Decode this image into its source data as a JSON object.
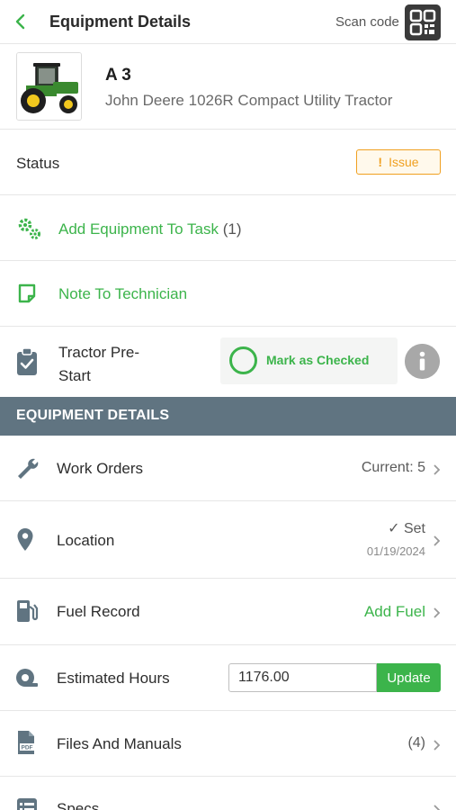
{
  "header": {
    "title": "Equipment Details",
    "scan_label": "Scan code"
  },
  "equipment": {
    "name": "A 3",
    "model": "John Deere 1026R Compact Utility Tractor"
  },
  "status": {
    "label": "Status",
    "badge": "Issue",
    "badge_mark": "!"
  },
  "add_to_task": {
    "label": "Add Equipment To Task",
    "count": "(1)"
  },
  "note": {
    "label": "Note To Technician"
  },
  "prestart": {
    "label_line1": "Tractor Pre-",
    "label_line2": "Start",
    "button": "Mark as Checked"
  },
  "section": {
    "title": "EQUIPMENT DETAILS"
  },
  "rows": {
    "work_orders": {
      "label": "Work Orders",
      "value": "Current: 5"
    },
    "location": {
      "label": "Location",
      "value": "Set",
      "date": "01/19/2024"
    },
    "fuel": {
      "label": "Fuel Record",
      "value": "Add Fuel"
    },
    "hours": {
      "label": "Estimated Hours",
      "input_value": "1176.00",
      "button": "Update"
    },
    "files": {
      "label": "Files And Manuals",
      "value": "(4)"
    },
    "specs": {
      "label": "Specs"
    }
  },
  "colors": {
    "accent": "#3cb44b",
    "warning": "#f0a020",
    "section_bar": "#607481"
  }
}
